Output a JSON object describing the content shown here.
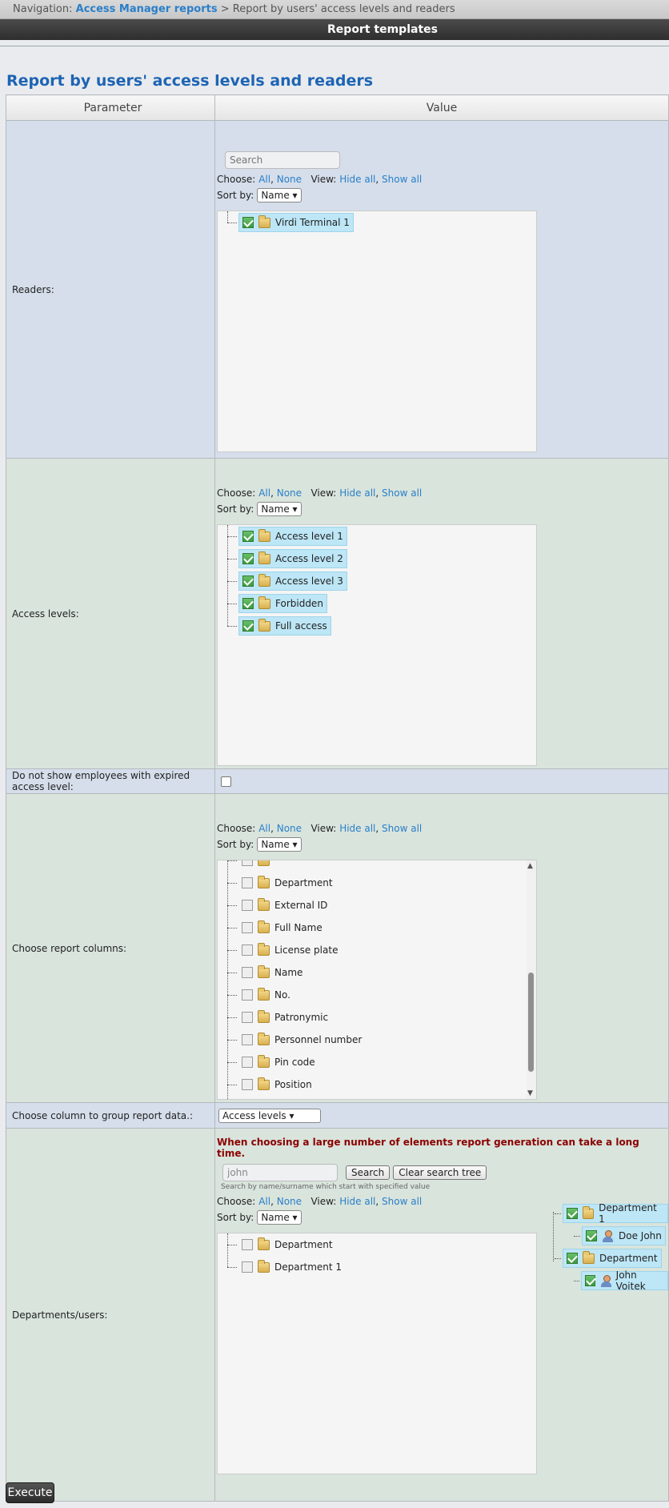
{
  "nav": {
    "prefix": "Navigation:",
    "link": "Access Manager reports",
    "sep": ">",
    "current": "Report by users' access levels and readers"
  },
  "titlebar": "Report templates",
  "page_title": "Report by users' access levels and readers",
  "table": {
    "header_param": "Parameter",
    "header_value": "Value"
  },
  "common": {
    "choose_prefix": "Choose:",
    "all": "All",
    "none": "None",
    "view_prefix": "View:",
    "hide_all": "Hide all",
    "show_all": "Show all",
    "sort_by": "Sort by:",
    "sort_value": "Name"
  },
  "readers": {
    "label": "Readers:",
    "search_placeholder": "Search",
    "items": [
      {
        "label": "Virdi Terminal 1",
        "checked": true
      }
    ]
  },
  "access_levels": {
    "label": "Access levels:",
    "items": [
      {
        "label": "Access level 1",
        "checked": true
      },
      {
        "label": "Access level 2",
        "checked": true
      },
      {
        "label": "Access level 3",
        "checked": true
      },
      {
        "label": "Forbidden",
        "checked": true
      },
      {
        "label": "Full access",
        "checked": true
      }
    ]
  },
  "expired": {
    "label": "Do not show employees with expired access level:"
  },
  "columns": {
    "label": "Choose report columns:",
    "items": [
      "Department",
      "External ID",
      "Full Name",
      "License plate",
      "Name",
      "No.",
      "Patronymic",
      "Personnel number",
      "Pin code",
      "Position"
    ]
  },
  "group": {
    "label": "Choose column to group report data.:",
    "value": "Access levels"
  },
  "departments": {
    "label": "Departments/users:",
    "warning": "When choosing a large number of elements report generation can take a long time.",
    "search_value": "john",
    "search_button": "Search",
    "clear_button": "Clear search tree",
    "hint": "Search by name/surname which start with specified value",
    "left_items": [
      "Department",
      "Department 1"
    ],
    "right_tree": [
      {
        "label": "Department 1",
        "child": "Doe John"
      },
      {
        "label": "Department",
        "child": "John Voitek"
      }
    ]
  },
  "execute": "Execute"
}
